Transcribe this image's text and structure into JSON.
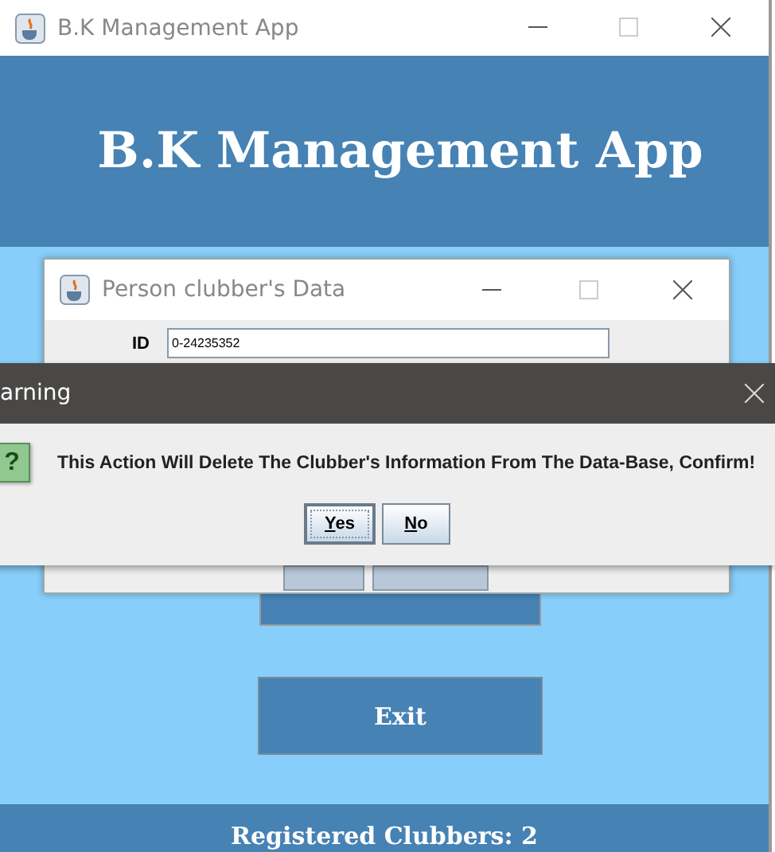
{
  "main_window": {
    "title": "B.K Management App",
    "header": "B.K Management App",
    "exit_button": "Exit",
    "status_bar": "Registered Clubbers: 2"
  },
  "data_dialog": {
    "title": "Person clubber's Data",
    "fields": [
      {
        "label": "ID",
        "value": "0-24235352"
      }
    ]
  },
  "warning_dialog": {
    "title": "arning",
    "icon": "?",
    "message": "This Action Will Delete The Clubber's Information From The Data-Base, Confirm!",
    "buttons": [
      {
        "label": "Yes",
        "selected": true
      },
      {
        "label": "No",
        "selected": false
      }
    ]
  }
}
